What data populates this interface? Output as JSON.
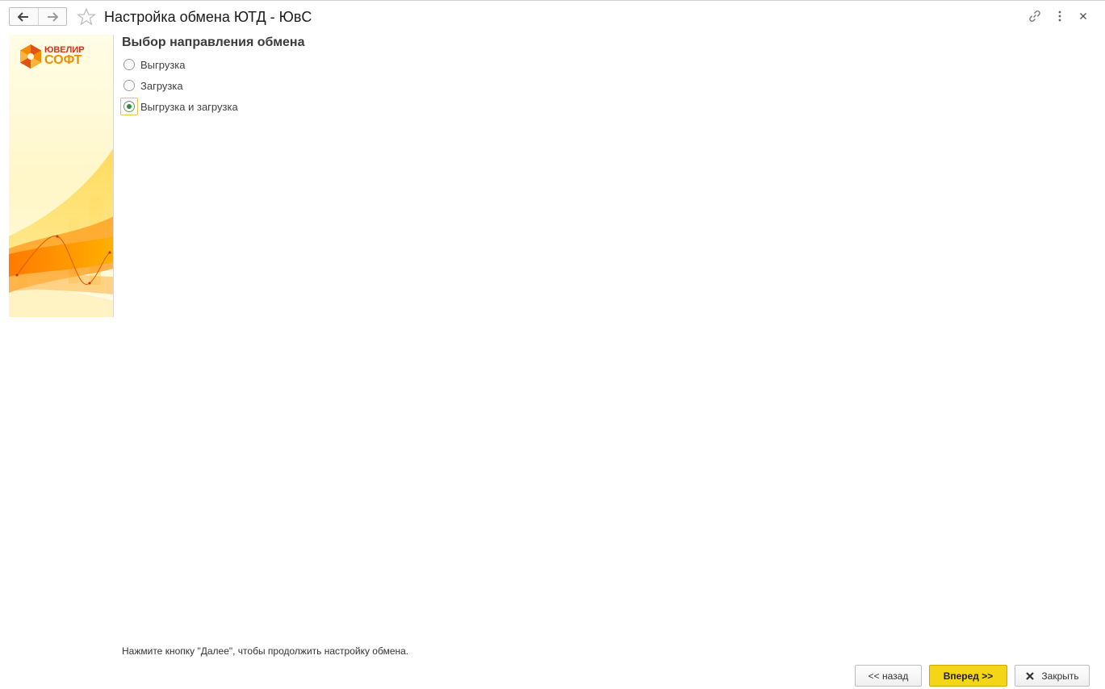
{
  "window": {
    "title": "Настройка обмена ЮТД - ЮвС"
  },
  "banner": {
    "logo_line1": "ЮВЕЛИР",
    "logo_line2": "СОФТ"
  },
  "form": {
    "heading": "Выбор направления обмена",
    "options": [
      {
        "label": "Выгрузка",
        "checked": false
      },
      {
        "label": "Загрузка",
        "checked": false
      },
      {
        "label": "Выгрузка и загрузка",
        "checked": true
      }
    ],
    "hint": "Нажмите кнопку \"Далее\", чтобы продолжить настройку обмена."
  },
  "buttons": {
    "back_label": "<< назад",
    "next_label": "Вперед >>",
    "close_label": "Закрыть"
  },
  "colors": {
    "accent_button": "#f5d518",
    "radio_checked": "#2e8b3a"
  }
}
